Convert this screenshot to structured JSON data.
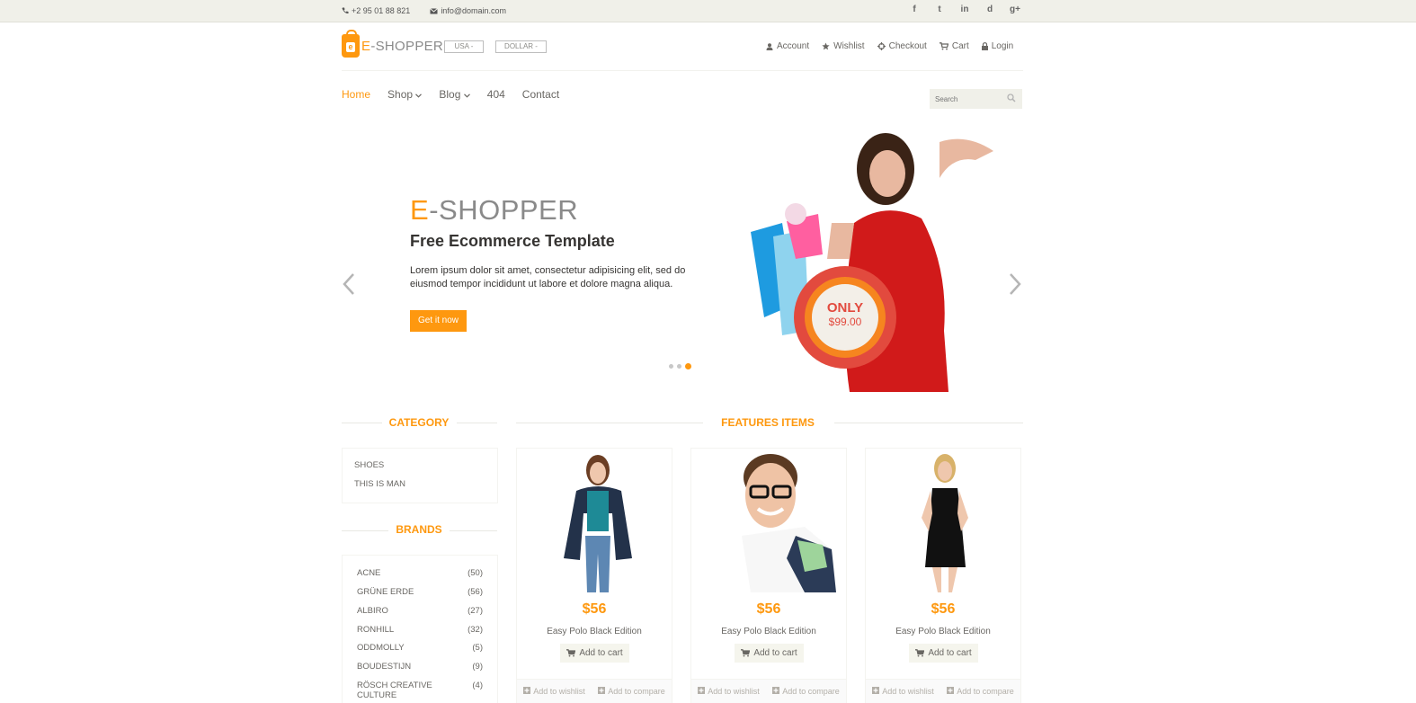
{
  "topbar": {
    "phone": "+2 95 01 88 821",
    "email": "info@domain.com",
    "social": [
      "f",
      "t",
      "in",
      "d",
      "g+"
    ]
  },
  "header": {
    "logo_e": "E",
    "logo_rest": "-SHOPPER",
    "country": "USA -",
    "currency": "DOLLAR -",
    "menu": [
      "Account",
      "Wishlist",
      "Checkout",
      "Cart",
      "Login"
    ]
  },
  "nav": {
    "items": [
      "Home",
      "Shop",
      "Blog",
      "404",
      "Contact"
    ],
    "search_placeholder": "Search"
  },
  "slider": {
    "title_e": "E",
    "title_rest": "-SHOPPER",
    "subtitle": "Free Ecommerce Template",
    "description": "Lorem ipsum dolor sit amet, consectetur adipisicing elit, sed do eiusmod tempor incididunt ut labore et dolore magna aliqua.",
    "button": "Get it now",
    "badge_top": "ONLY",
    "badge_price": "$99.00",
    "active_dot": 3
  },
  "category": {
    "title": "CATEGORY",
    "items": [
      "SHOES",
      "THIS IS MAN"
    ]
  },
  "brands": {
    "title": "BRANDS",
    "items": [
      {
        "name": "ACNE",
        "count": "(50)"
      },
      {
        "name": "GRÜNE ERDE",
        "count": "(56)"
      },
      {
        "name": "ALBIRO",
        "count": "(27)"
      },
      {
        "name": "RONHILL",
        "count": "(32)"
      },
      {
        "name": "ODDMOLLY",
        "count": "(5)"
      },
      {
        "name": "BOUDESTIJN",
        "count": "(9)"
      },
      {
        "name": "RÖSCH CREATIVE CULTURE",
        "count": "(4)"
      }
    ]
  },
  "features": {
    "title": "FEATURES ITEMS",
    "products": [
      {
        "price": "$56",
        "name": "Easy Polo Black Edition",
        "add": "Add to cart",
        "wishlist": "Add to wishlist",
        "compare": "Add to compare"
      },
      {
        "price": "$56",
        "name": "Easy Polo Black Edition",
        "add": "Add to cart",
        "wishlist": "Add to wishlist",
        "compare": "Add to compare"
      },
      {
        "price": "$56",
        "name": "Easy Polo Black Edition",
        "add": "Add to cart",
        "wishlist": "Add to wishlist",
        "compare": "Add to compare"
      }
    ]
  },
  "colors": {
    "accent": "#FE980F",
    "topbar": "#F0F0E9",
    "text": "#696763",
    "dark": "#363432"
  }
}
